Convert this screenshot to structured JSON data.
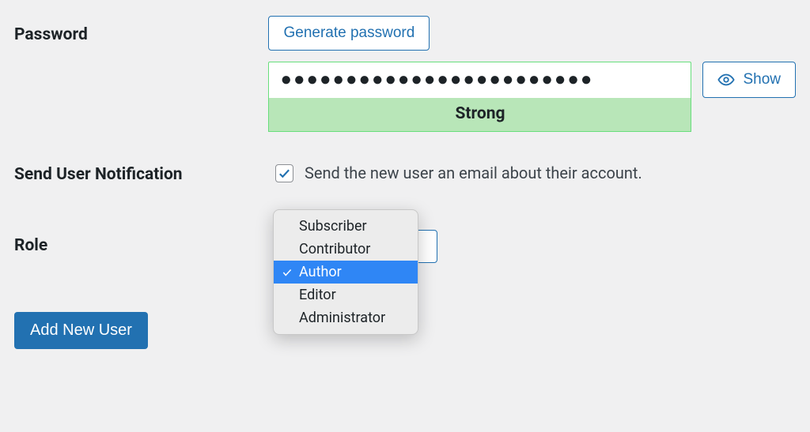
{
  "password": {
    "label": "Password",
    "generate_label": "Generate password",
    "masked_value": "●●●●●●●●●●●●●●●●●●●●●●●●",
    "strength": "Strong",
    "show_label": "Show"
  },
  "notification": {
    "label": "Send User Notification",
    "description": "Send the new user an email about their account.",
    "checked": true
  },
  "role": {
    "label": "Role",
    "selected": "Author",
    "options": [
      "Subscriber",
      "Contributor",
      "Author",
      "Editor",
      "Administrator"
    ]
  },
  "submit": {
    "label": "Add New User"
  }
}
